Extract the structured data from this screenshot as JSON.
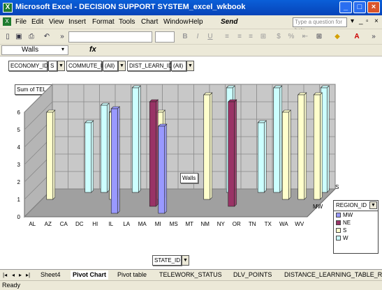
{
  "window": {
    "title": "Microsoft Excel - DECISION SUPPORT SYSTEM_excel_wkbook",
    "app_icon": "excel-icon"
  },
  "menu": {
    "items": [
      "File",
      "Edit",
      "View",
      "Insert",
      "Format",
      "Tools",
      "Chart",
      "Window",
      "Help"
    ],
    "send_label": "Send",
    "help_placeholder": "Type a question for help"
  },
  "formula_bar": {
    "name_box": "Walls",
    "fx_label": "fx"
  },
  "pivot": {
    "page_fields": [
      {
        "name": "ECONOMY_ID",
        "value": "S"
      },
      {
        "name": "COMMUTE_ID",
        "value": "(All)"
      },
      {
        "name": "DIST_LEARN_ID",
        "value": "(All)"
      }
    ],
    "data_field": "Sum of TEL_STATUS_POINTS",
    "category_field": "STATE_ID",
    "series_field": "REGION_ID",
    "tooltip": "Walls"
  },
  "legend": {
    "title": "REGION_ID",
    "items": [
      {
        "label": "MW",
        "color": "#9999ff"
      },
      {
        "label": "NE",
        "color": "#993366"
      },
      {
        "label": "S",
        "color": "#ffffcc"
      },
      {
        "label": "W",
        "color": "#ccffff"
      }
    ]
  },
  "chart_data": {
    "type": "bar",
    "title": "",
    "xlabel": "",
    "ylabel": "",
    "ylim": [
      0,
      6
    ],
    "y_ticks": [
      "0",
      "1",
      "2",
      "3",
      "4",
      "5",
      "6"
    ],
    "depth_labels": [
      "S",
      "MW"
    ],
    "categories": [
      "AL",
      "AZ",
      "CA",
      "DC",
      "HI",
      "IL",
      "LA",
      "MA",
      "MI",
      "MS",
      "MT",
      "NM",
      "NY",
      "OR",
      "TN",
      "TX",
      "WA",
      "WV"
    ],
    "series": [
      {
        "name": "MW",
        "values": [
          0,
          0,
          0,
          0,
          0,
          6,
          0,
          0,
          5,
          0,
          0,
          0,
          0,
          0,
          0,
          0,
          0,
          0
        ]
      },
      {
        "name": "NE",
        "values": [
          0,
          0,
          0,
          0,
          0,
          0,
          0,
          6,
          0,
          0,
          0,
          0,
          6,
          0,
          0,
          0,
          0,
          0
        ]
      },
      {
        "name": "S",
        "values": [
          5,
          0,
          0,
          0,
          5,
          0,
          0,
          5,
          0,
          0,
          6,
          0,
          0,
          0,
          0,
          5,
          6,
          6
        ]
      },
      {
        "name": "W",
        "values": [
          0,
          0,
          4,
          5,
          0,
          6,
          0,
          0,
          0,
          0,
          0,
          6,
          0,
          4,
          6,
          0,
          0,
          6
        ]
      }
    ]
  },
  "sheet_tabs": [
    "Sheet4",
    "Pivot Chart",
    "Pivot table",
    "TELEWORK_STATUS",
    "DLV_POINTS",
    "DISTANCE_LEARNING_TABLE_RA"
  ],
  "active_tab": "Pivot Chart",
  "status": "Ready"
}
